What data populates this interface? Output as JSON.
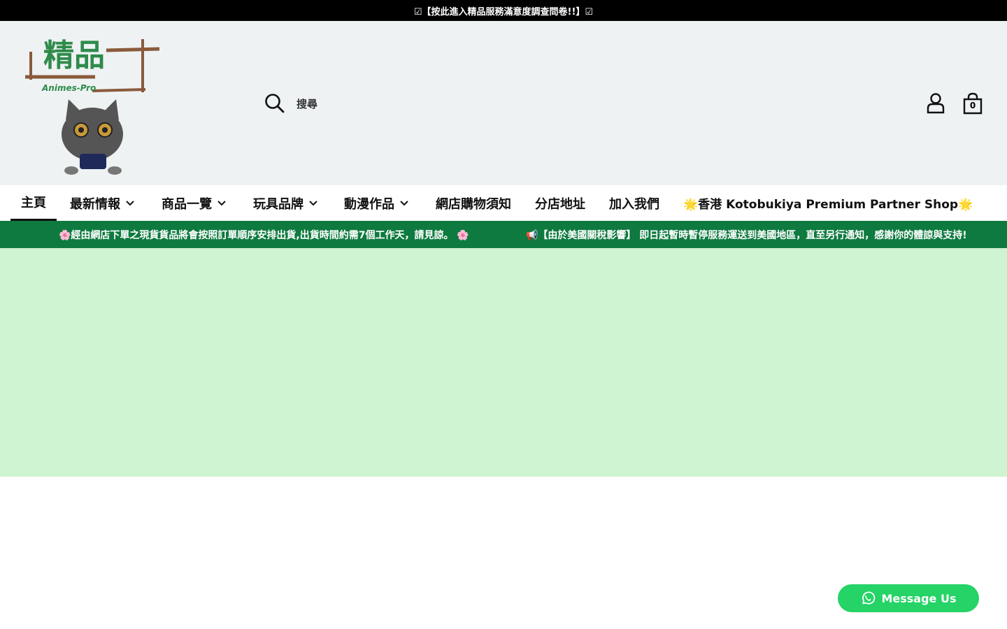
{
  "announcement": {
    "text": "☑【按此進入精品服務滿意度調查問卷!!】☑"
  },
  "header": {
    "logo": {
      "title": "精品",
      "subtitle": "Animes-Pro"
    },
    "search": {
      "label": "搜尋",
      "icon": "search-icon"
    },
    "account": {
      "icon": "user-icon"
    },
    "cart": {
      "icon": "shopping-bag-icon",
      "count": "0"
    }
  },
  "nav": {
    "items": [
      {
        "label": "主頁",
        "active": true,
        "dropdown": false
      },
      {
        "label": "最新情報",
        "dropdown": true
      },
      {
        "label": "商品一覽",
        "dropdown": true
      },
      {
        "label": "玩具品牌",
        "dropdown": true
      },
      {
        "label": "動漫作品",
        "dropdown": true
      },
      {
        "label": "網店購物須知",
        "dropdown": false
      },
      {
        "label": "分店地址",
        "dropdown": false
      },
      {
        "label": "加入我們",
        "dropdown": false
      },
      {
        "label": "🌟香港 Kotobukiya Premium Partner Shop🌟",
        "dropdown": false
      }
    ]
  },
  "promo": {
    "messages": [
      "🌸經由網店下單之現貨貨品將會按照訂單順序安排出貨,出貨時間約需7個工作天，請見諒。 🌸",
      "📢【由於美國關稅影響】 即日起暫時暫停服務運送到美國地區，直至另行通知，感謝你的體諒與支持!"
    ]
  },
  "whatsapp": {
    "label": "Message Us",
    "icon": "whatsapp-icon"
  },
  "colors": {
    "announcement_bg": "#000000",
    "header_bg": "#eef2f3",
    "promo_bg": "#0e7a3f",
    "hero_bg": "#cff4d2",
    "whatsapp": "#25d366",
    "logo_green": "#2e8b4a",
    "logo_brown": "#8b5a3c"
  }
}
